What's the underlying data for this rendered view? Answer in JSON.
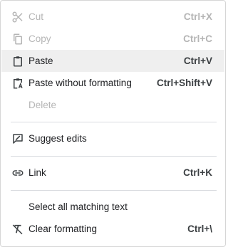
{
  "menu": {
    "items": [
      {
        "label": "Cut",
        "shortcut": "Ctrl+X",
        "icon": "scissors-icon",
        "disabled": true
      },
      {
        "label": "Copy",
        "shortcut": "Ctrl+C",
        "icon": "copy-icon",
        "disabled": true
      },
      {
        "label": "Paste",
        "shortcut": "Ctrl+V",
        "icon": "clipboard-icon",
        "disabled": false,
        "highlighted": true
      },
      {
        "label": "Paste without formatting",
        "shortcut": "Ctrl+Shift+V",
        "icon": "clipboard-text-icon",
        "disabled": false
      },
      {
        "label": "Delete",
        "shortcut": "",
        "icon": "",
        "disabled": true
      },
      {
        "label": "Suggest edits",
        "shortcut": "",
        "icon": "suggest-edit-icon",
        "disabled": false
      },
      {
        "label": "Link",
        "shortcut": "Ctrl+K",
        "icon": "link-icon",
        "disabled": false
      },
      {
        "label": "Select all matching text",
        "shortcut": "",
        "icon": "",
        "disabled": false
      },
      {
        "label": "Clear formatting",
        "shortcut": "Ctrl+\\",
        "icon": "clear-formatting-icon",
        "disabled": false
      }
    ]
  },
  "colors": {
    "text": "#202124",
    "disabled_text": "#b5b5b5",
    "highlight_bg": "#efefef",
    "separator": "#dadce0"
  }
}
